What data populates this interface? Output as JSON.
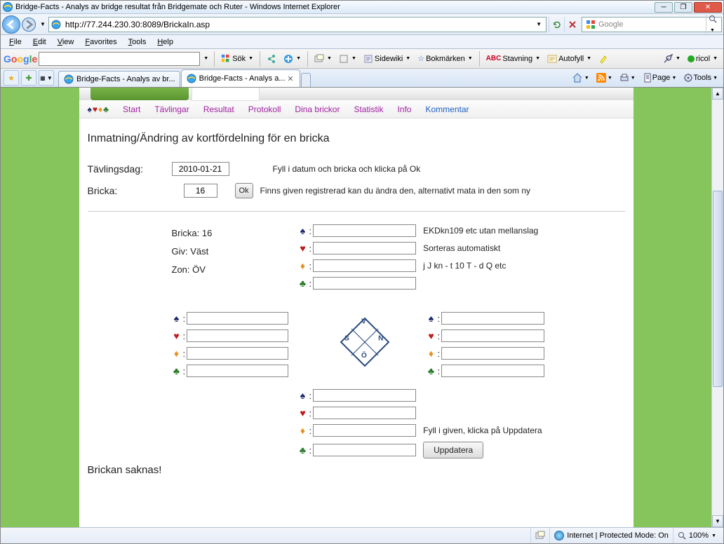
{
  "window": {
    "title": "Bridge-Facts - Analys av bridge resultat från Bridgemate och Ruter - Windows Internet Explorer"
  },
  "address": {
    "url": "http://77.244.230.30:8089/BrickaIn.asp"
  },
  "search": {
    "placeholder": "Google"
  },
  "menu": {
    "file": "File",
    "edit": "Edit",
    "view": "View",
    "favorites": "Favorites",
    "tools": "Tools",
    "help": "Help"
  },
  "google_toolbar": {
    "search_label": "Sök",
    "sidewiki": "Sidewiki",
    "bookmarks": "Bokmärken",
    "spellcheck": "Stavning",
    "autofill": "Autofyll",
    "user": "ricol"
  },
  "tabs": {
    "t1": "Bridge-Facts - Analys av br...",
    "t2": "Bridge-Facts - Analys a..."
  },
  "rtools": {
    "page": "Page",
    "tools": "Tools"
  },
  "sitenav": {
    "start": "Start",
    "tavlingar": "Tävlingar",
    "resultat": "Resultat",
    "protokoll": "Protokoll",
    "dina": "Dina brickor",
    "statistik": "Statistik",
    "info": "Info",
    "kommentar": "Kommentar"
  },
  "page": {
    "title": "Inmatning/Ändring av kortfördelning för en bricka",
    "tavlingsdag_label": "Tävlingsdag:",
    "tavlingsdag_value": "2010-01-21",
    "bricka_label": "Bricka:",
    "bricka_value": "16",
    "hint1": "Fyll i datum och bricka och klicka på Ok",
    "hint2": "Finns given registrerad kan du ändra den, alternativt mata in den som ny",
    "ok": "Ok",
    "info_bricka": "Bricka: 16",
    "info_giv": "Giv: Väst",
    "info_zon": "Zon: ÖV",
    "n_hint_s": "EKDkn109 etc utan mellanslag",
    "n_hint_h": "Sorteras automatiskt",
    "n_hint_d": "j J kn - t 10 T - d Q etc",
    "s_hint_d": "Fyll i given, klicka på Uppdatera",
    "update": "Uppdatera",
    "missing": "Brickan saknas!"
  },
  "compass": {
    "n": "N",
    "e": "Ö",
    "s": "S",
    "w": "V"
  },
  "statusbar": {
    "zone": "Internet | Protected Mode: On",
    "zoom": "100%"
  }
}
